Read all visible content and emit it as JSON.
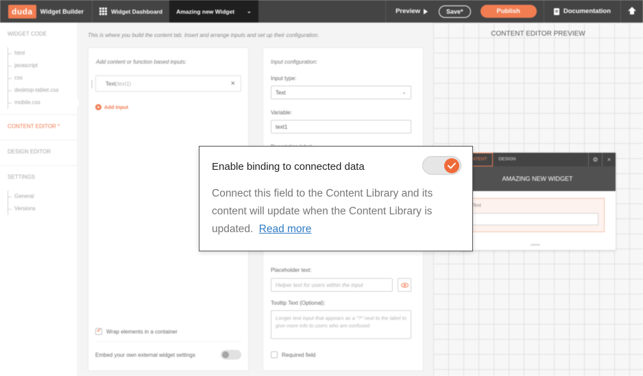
{
  "topbar": {
    "logo": "duda",
    "app_title": "Widget Builder",
    "dashboard_label": "Widget Dashboard",
    "widget_name": "Amazing new Widget",
    "widget_dropdown_icon": "chevron-down-icon",
    "preview_label": "Preview",
    "save_label": "Save*",
    "publish_label": "Publish",
    "documentation_label": "Documentation",
    "accent_color": "#ef6b3a"
  },
  "sidebar": {
    "widget_code": "WIDGET CODE",
    "code_files": [
      "html",
      "javascript",
      "css",
      "desktop-tablet.css",
      "mobile.css"
    ],
    "content_editor": "CONTENT EDITOR *",
    "design_editor": "DESIGN EDITOR",
    "settings": "SETTINGS",
    "settings_items": [
      "General",
      "Versions"
    ]
  },
  "main": {
    "intro": "This is where you build the content tab. Insert and arrange inputs and set up their configuration.",
    "left_card": {
      "title": "Add content or function based inputs:",
      "input_label": "Text",
      "input_variable": "(text1)",
      "add_input": "Add Input",
      "wrap_label": "Wrap elements in a container",
      "wrap_checked": true,
      "embed_label": "Embed your own external widget settings",
      "embed_enabled": false
    },
    "right_card": {
      "title": "Input configuration:",
      "input_type_label": "Input type:",
      "input_type_value": "Text",
      "variable_label": "Variable:",
      "variable_value": "text1",
      "description_label": "Description label:",
      "placeholder_label": "Placeholder text:",
      "placeholder_value": "Helper text for users within the input",
      "tooltip_label": "Tooltip Text (Optional):",
      "tooltip_value": "Longer text input that appears as a \"?\" next to the label to give more info to users who are confused",
      "required_label": "Required field"
    }
  },
  "preview": {
    "title": "CONTENT EDITOR PREVIEW",
    "tabs": [
      "CONTENT",
      "DESIGN"
    ],
    "widget_name": "AMAZING NEW WIDGET",
    "field_label": "Text"
  },
  "popover": {
    "title": "Enable binding to connected data",
    "body": "Connect this field to the Content Library and its content will update when the Content Library is updated.",
    "link": "Read more",
    "toggle_on": true
  }
}
